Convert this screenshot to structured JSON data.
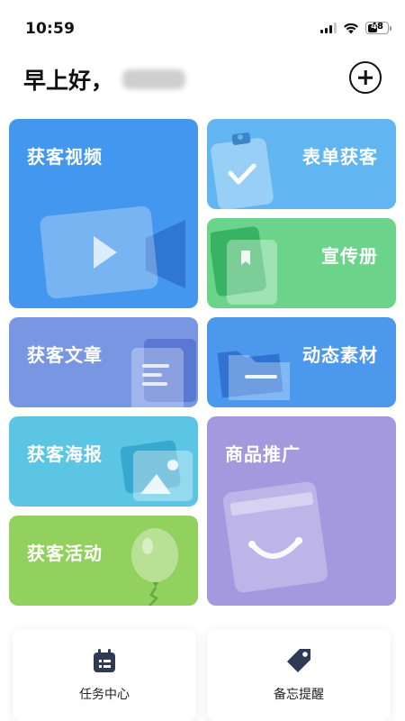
{
  "status_bar": {
    "time": "10:59",
    "battery": "48"
  },
  "header": {
    "greeting": "早上好，"
  },
  "cards": {
    "video": "获客视频",
    "form": "表单获客",
    "brochure": "宣传册",
    "article": "获客文章",
    "material": "动态素材",
    "poster": "获客海报",
    "product": "商品推广",
    "activity": "获客活动"
  },
  "tiles": {
    "tasks": "任务中心",
    "reminders": "备忘提醒"
  },
  "colors": {
    "video": "#4497ee",
    "form": "#61b6f2",
    "brochure": "#6cd48a",
    "article": "#7896e2",
    "material": "#4b98ec",
    "poster": "#5bc5e3",
    "product": "#a498df",
    "activity": "#92d15e"
  }
}
